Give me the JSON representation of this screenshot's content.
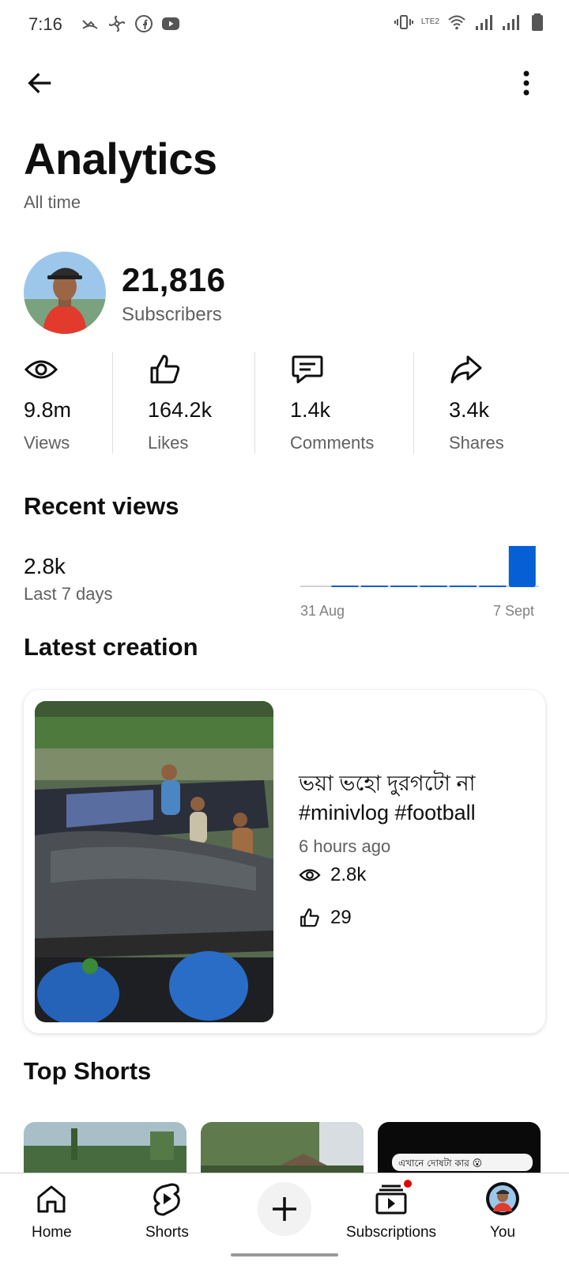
{
  "status_bar": {
    "time": "7:16",
    "network_label": "LTE2"
  },
  "header": {
    "title": "Analytics",
    "subtitle": "All time"
  },
  "channel": {
    "subscribers": "21,816",
    "subscribers_label": "Subscribers"
  },
  "stats": [
    {
      "icon": "eye-icon",
      "value": "9.8m",
      "label": "Views"
    },
    {
      "icon": "thumbs-up-icon",
      "value": "164.2k",
      "label": "Likes"
    },
    {
      "icon": "comment-icon",
      "value": "1.4k",
      "label": "Comments"
    },
    {
      "icon": "share-icon",
      "value": "3.4k",
      "label": "Shares"
    }
  ],
  "recent_views": {
    "title": "Recent views",
    "value": "2.8k",
    "label": "Last 7 days",
    "start_label": "31 Aug",
    "end_label": "7 Sept",
    "bar_color": "#065fd4",
    "bars": [
      0,
      0.02,
      0.02,
      0.02,
      0.02,
      0.02,
      0.02,
      1
    ]
  },
  "latest_creation": {
    "title": "Latest creation",
    "video_title": "ভয়া ভহো দুরগটো না #minivlog #football",
    "published": "6 hours ago",
    "views": "2.8k",
    "likes": "29"
  },
  "top_shorts": {
    "title": "Top Shorts",
    "third_caption": "এখানে দোষটা কার 😮"
  },
  "bottom_nav": {
    "home": "Home",
    "shorts": "Shorts",
    "create": "Create",
    "subscriptions": "Subscriptions",
    "you": "You"
  },
  "colors": {
    "accent": "#065fd4",
    "notification_dot": "#e00000",
    "text_secondary": "#606060"
  }
}
